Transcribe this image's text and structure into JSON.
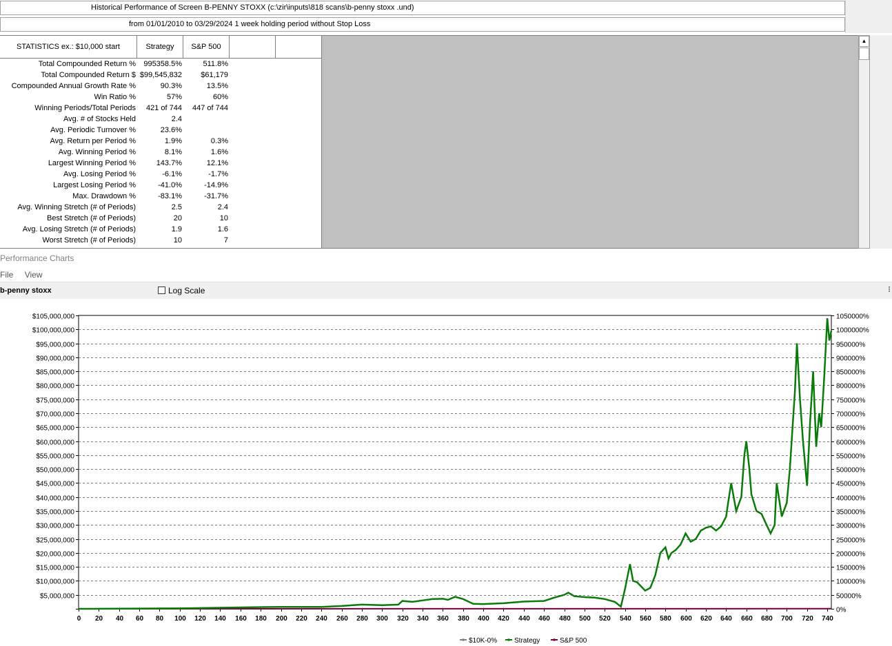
{
  "header": {
    "title": "Historical Performance of Screen B-PENNY STOXX (c:\\zir\\inputs\\818 scans\\b-penny stoxx .und)",
    "subtitle": "from 01/01/2010 to 03/29/2024 1 week holding period without Stop Loss"
  },
  "stats": {
    "headers": [
      "STATISTICS  ex.: $10,000 start",
      "Strategy",
      "S&P 500",
      "",
      ""
    ],
    "rows": [
      [
        "Total Compounded Return %",
        "995358.5%",
        "511.8%"
      ],
      [
        "Total Compounded Return $",
        "$99,545,832",
        "$61,179"
      ],
      [
        "Compounded Annual Growth Rate %",
        "90.3%",
        "13.5%"
      ],
      [
        "Win Ratio %",
        "57%",
        "60%"
      ],
      [
        "Winning Periods/Total Periods",
        "421 of 744",
        "447 of 744"
      ],
      [
        "Avg. # of Stocks Held",
        "2.4",
        ""
      ],
      [
        "Avg. Periodic Turnover %",
        "23.6%",
        ""
      ],
      [
        "Avg. Return per Period %",
        "1.9%",
        "0.3%"
      ],
      [
        "Avg. Winning Period %",
        "8.1%",
        "1.6%"
      ],
      [
        "Largest Winning Period %",
        "143.7%",
        "12.1%"
      ],
      [
        "Avg. Losing Period %",
        "-6.1%",
        "-1.7%"
      ],
      [
        "Largest Losing Period %",
        "-41.0%",
        "-14.9%"
      ],
      [
        "Max. Drawdown %",
        "-83.1%",
        "-31.7%"
      ],
      [
        "Avg. Winning Stretch (# of Periods)",
        "2.5",
        "2.4"
      ],
      [
        "Best Stretch (# of Periods)",
        "20",
        "10"
      ],
      [
        "Avg. Losing Stretch (# of Periods)",
        "1.9",
        "1.6"
      ],
      [
        "Worst Stretch (# of Periods)",
        "10",
        "7"
      ]
    ]
  },
  "scrollbar": {
    "up_arrow": "▲"
  },
  "performance": {
    "window_title": "Performance Charts",
    "menu": [
      "File",
      "View"
    ],
    "series_label": "b-penny stoxx",
    "log_scale_label": "Log Scale",
    "toolbar_mark": "⁝"
  },
  "colors": {
    "strategy": "#0a7a0a",
    "baseline": "#808080",
    "sp500": "#800040"
  },
  "chart_data": {
    "type": "line",
    "x_ticks": [
      0,
      20,
      40,
      60,
      80,
      100,
      120,
      140,
      160,
      180,
      200,
      220,
      240,
      260,
      280,
      300,
      320,
      340,
      360,
      380,
      400,
      420,
      440,
      460,
      480,
      500,
      520,
      540,
      560,
      580,
      600,
      620,
      640,
      660,
      680,
      700,
      720,
      740
    ],
    "xlim": [
      0,
      744
    ],
    "ylim": [
      0,
      105000000
    ],
    "y_ticks_left": [
      "$5,000,000",
      "$10,000,000",
      "$15,000,000",
      "$20,000,000",
      "$25,000,000",
      "$30,000,000",
      "$35,000,000",
      "$40,000,000",
      "$45,000,000",
      "$50,000,000",
      "$55,000,000",
      "$60,000,000",
      "$65,000,000",
      "$70,000,000",
      "$75,000,000",
      "$80,000,000",
      "$85,000,000",
      "$90,000,000",
      "$95,000,000",
      "$100,000,000",
      "$105,000,000"
    ],
    "y_ticks_right": [
      "0%",
      "50000%",
      "100000%",
      "150000%",
      "200000%",
      "250000%",
      "300000%",
      "350000%",
      "400000%",
      "450000%",
      "500000%",
      "550000%",
      "600000%",
      "650000%",
      "700000%",
      "750000%",
      "800000%",
      "850000%",
      "900000%",
      "950000%",
      "1000000%",
      "1050000%"
    ],
    "grid": true,
    "legend_position": "bottom-center",
    "series": [
      {
        "name": "$10K-0%",
        "x": [
          0,
          744
        ],
        "y": [
          10000,
          10000
        ]
      },
      {
        "name": "Strategy",
        "x": [
          0,
          100,
          160,
          200,
          240,
          260,
          280,
          300,
          316,
          320,
          330,
          340,
          350,
          360,
          365,
          372,
          380,
          390,
          400,
          420,
          440,
          460,
          470,
          480,
          484,
          490,
          500,
          510,
          520,
          530,
          536,
          540,
          545,
          548,
          552,
          556,
          560,
          565,
          570,
          575,
          580,
          583,
          586,
          590,
          595,
          600,
          605,
          610,
          615,
          620,
          625,
          630,
          635,
          640,
          642,
          645,
          650,
          655,
          658,
          660,
          663,
          665,
          670,
          675,
          680,
          684,
          688,
          690,
          695,
          700,
          703,
          708,
          710,
          713,
          716,
          719,
          720,
          723,
          726,
          729,
          732,
          734,
          737,
          740,
          742,
          744
        ],
        "y": [
          10000,
          150000,
          500000,
          700000,
          700000,
          1000000,
          1500000,
          1300000,
          1500000,
          2800000,
          2500000,
          3000000,
          3500000,
          3600000,
          3200000,
          4300000,
          3500000,
          1800000,
          1700000,
          2000000,
          2600000,
          2800000,
          4000000,
          5000000,
          5800000,
          4500000,
          4200000,
          4000000,
          3500000,
          2500000,
          800000,
          7000000,
          16000000,
          10000000,
          9500000,
          8000000,
          6500000,
          7500000,
          12000000,
          20000000,
          22000000,
          18000000,
          20000000,
          21000000,
          23000000,
          27000000,
          24000000,
          25000000,
          28000000,
          29000000,
          29500000,
          28000000,
          29500000,
          33000000,
          38000000,
          45000000,
          35000000,
          40000000,
          55000000,
          60000000,
          50000000,
          41000000,
          35000000,
          34000000,
          30000000,
          27000000,
          30000000,
          45000000,
          33000000,
          38000000,
          50000000,
          78000000,
          95000000,
          75000000,
          60000000,
          48000000,
          44000000,
          67000000,
          85000000,
          58000000,
          70000000,
          65000000,
          83000000,
          104000000,
          96000000,
          99545832
        ]
      },
      {
        "name": "S&P 500",
        "x": [
          0,
          744
        ],
        "y": [
          10000,
          61179
        ]
      }
    ]
  }
}
